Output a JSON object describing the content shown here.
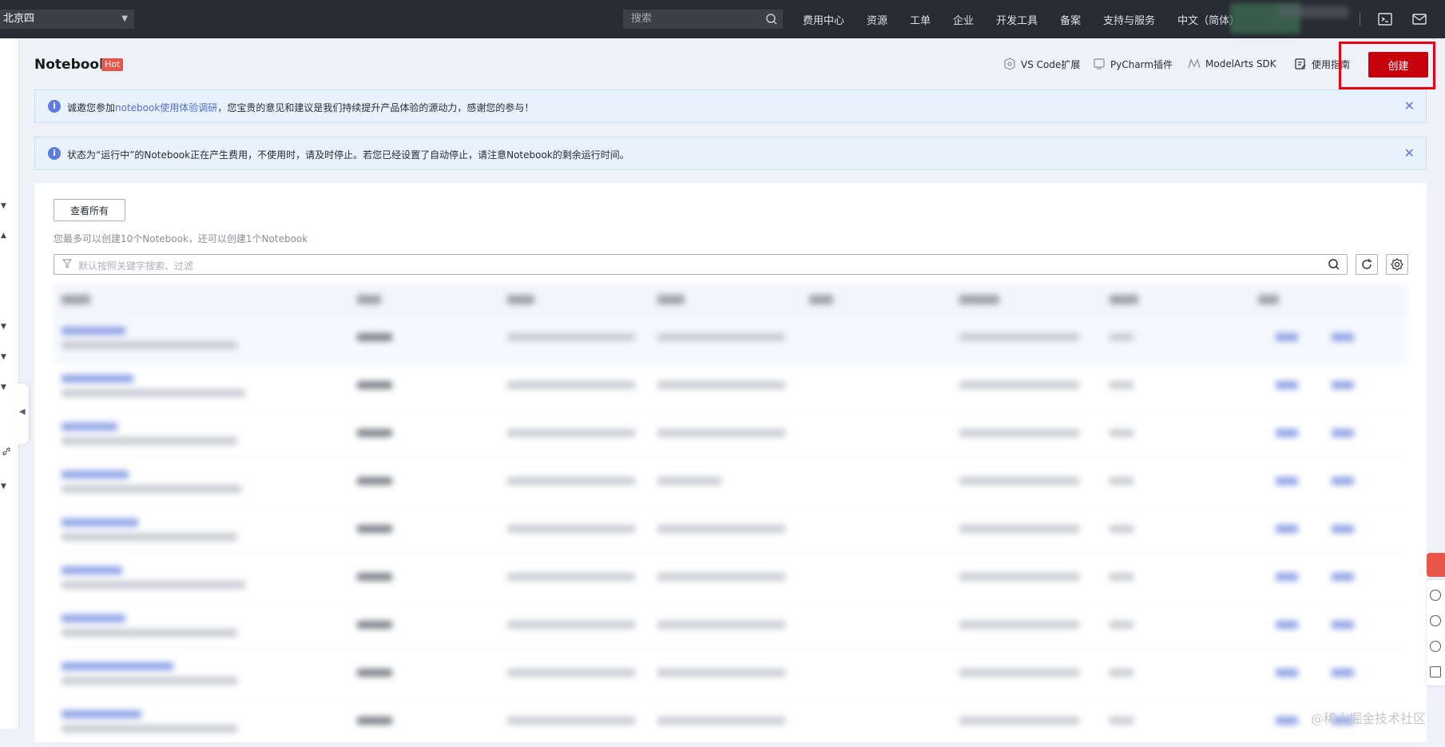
{
  "topbar": {
    "region": "北京四",
    "search_placeholder": "搜索",
    "nav": [
      "费用中心",
      "资源",
      "工单",
      "企业",
      "开发工具",
      "备案",
      "支持与服务",
      "中文（简体）"
    ]
  },
  "header": {
    "title": "Notebook",
    "badge": "Hot",
    "links": [
      "VS Code扩展",
      "PyCharm插件",
      "ModelArts SDK",
      "使用指南"
    ],
    "create_label": "创建"
  },
  "alerts": [
    {
      "prefix": "诚邀您参加",
      "link": "notebook使用体验调研",
      "suffix": "，您宝贵的意见和建议是我们持续提升产品体验的源动力，感谢您的参与！"
    },
    {
      "prefix": "状态为“运行中”的Notebook正在产生费用，不使用时，请及时停止。若您已经设置了自动停止，请注意Notebook的剩余运行时间。",
      "link": "",
      "suffix": ""
    }
  ],
  "main": {
    "view_all_label": "查看所有",
    "quota_text": "您最多可以创建10个Notebook，还可以创建1个Notebook",
    "filter_placeholder": "默认按照关键字搜索、过滤"
  },
  "colors": {
    "topbar": "#272b33",
    "primary_red": "#c7000b",
    "link_blue": "#526ecc",
    "alert_bg": "#e8f2fd"
  },
  "watermark": "@稀土掘金技术社区"
}
